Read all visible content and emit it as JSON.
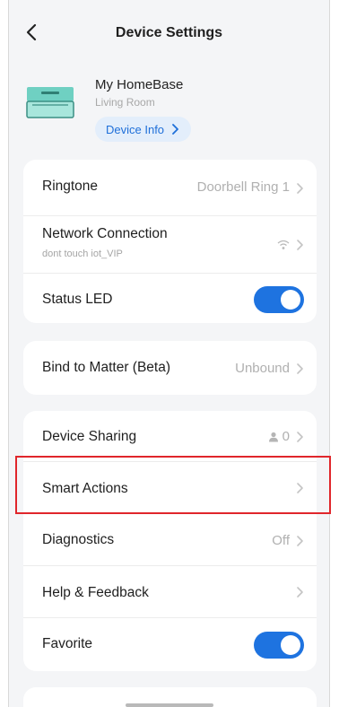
{
  "header": {
    "title": "Device Settings"
  },
  "device": {
    "name": "My HomeBase",
    "room": "Living Room",
    "info_label": "Device Info"
  },
  "group1": {
    "ringtone": {
      "label": "Ringtone",
      "value": "Doorbell Ring 1"
    },
    "network": {
      "label": "Network Connection",
      "sub": "dont touch iot_VIP"
    },
    "status_led": {
      "label": "Status LED",
      "on": true
    }
  },
  "group2": {
    "matter": {
      "label": "Bind to Matter (Beta)",
      "value": "Unbound"
    }
  },
  "group3": {
    "sharing": {
      "label": "Device Sharing",
      "count": "0"
    },
    "smart_actions": {
      "label": "Smart Actions"
    },
    "diagnostics": {
      "label": "Diagnostics",
      "value": "Off"
    },
    "help": {
      "label": "Help & Feedback"
    },
    "favorite": {
      "label": "Favorite",
      "on": true
    }
  },
  "colors": {
    "accent": "#1e73e0",
    "highlight": "#e0262b",
    "pill_bg": "#e3eefb"
  },
  "icons": [
    "back-chevron-icon",
    "homebase-device-icon",
    "chevron-right-icon",
    "wifi-icon",
    "person-icon"
  ]
}
